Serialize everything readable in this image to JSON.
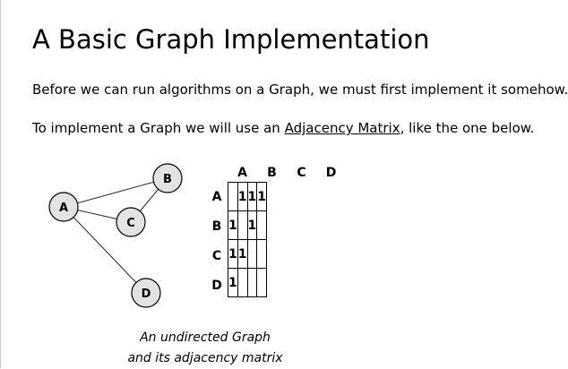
{
  "title": "A Basic Graph Implementation",
  "paragraph1": "Before we can run algorithms on a Graph, we must first implement it somehow.",
  "paragraph2": {
    "before": "To implement a Graph we will use an ",
    "link": "Adjacency Matrix",
    "after": ", like the one below."
  },
  "graph": {
    "nodes": [
      "A",
      "B",
      "C",
      "D"
    ],
    "edges": [
      [
        "A",
        "B"
      ],
      [
        "A",
        "C"
      ],
      [
        "A",
        "D"
      ],
      [
        "B",
        "C"
      ]
    ]
  },
  "matrix": {
    "columns": [
      "A",
      "B",
      "C",
      "D"
    ],
    "rows": [
      {
        "label": "A",
        "cells": [
          "",
          "1",
          "1",
          "1"
        ]
      },
      {
        "label": "B",
        "cells": [
          "1",
          "",
          "1",
          ""
        ]
      },
      {
        "label": "C",
        "cells": [
          "1",
          "1",
          "",
          ""
        ]
      },
      {
        "label": "D",
        "cells": [
          "1",
          "",
          "",
          ""
        ]
      }
    ]
  },
  "caption": {
    "line1": "An undirected Graph",
    "line2": "and its adjacency matrix"
  },
  "colors": {
    "node_fill": "#e3e3e3",
    "text": "#000000"
  }
}
